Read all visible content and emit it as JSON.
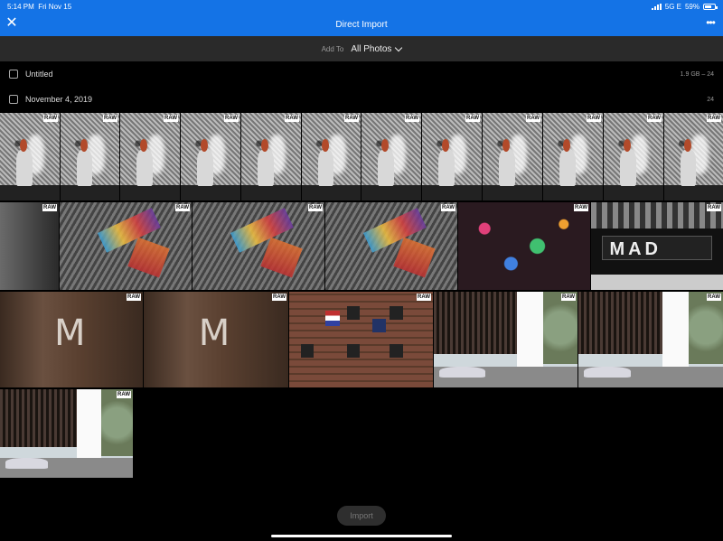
{
  "status_bar": {
    "time": "5:14 PM",
    "date": "Fri Nov 15",
    "network": "5G E",
    "battery": "59%",
    "battery_level": 0.59
  },
  "header": {
    "title": "Direct Import",
    "close_icon": "close-icon",
    "more_icon": "more-icon"
  },
  "add_to": {
    "label": "Add To",
    "value": "All Photos"
  },
  "groups": [
    {
      "name": "Untitled",
      "meta": "1.9 GB – 24"
    },
    {
      "name": "November 4, 2019",
      "meta": "24"
    }
  ],
  "thumbnails": {
    "raw_badge": "RAW",
    "door_letter": "M",
    "mad_text": "MAD"
  },
  "footer": {
    "import_label": "Import"
  }
}
